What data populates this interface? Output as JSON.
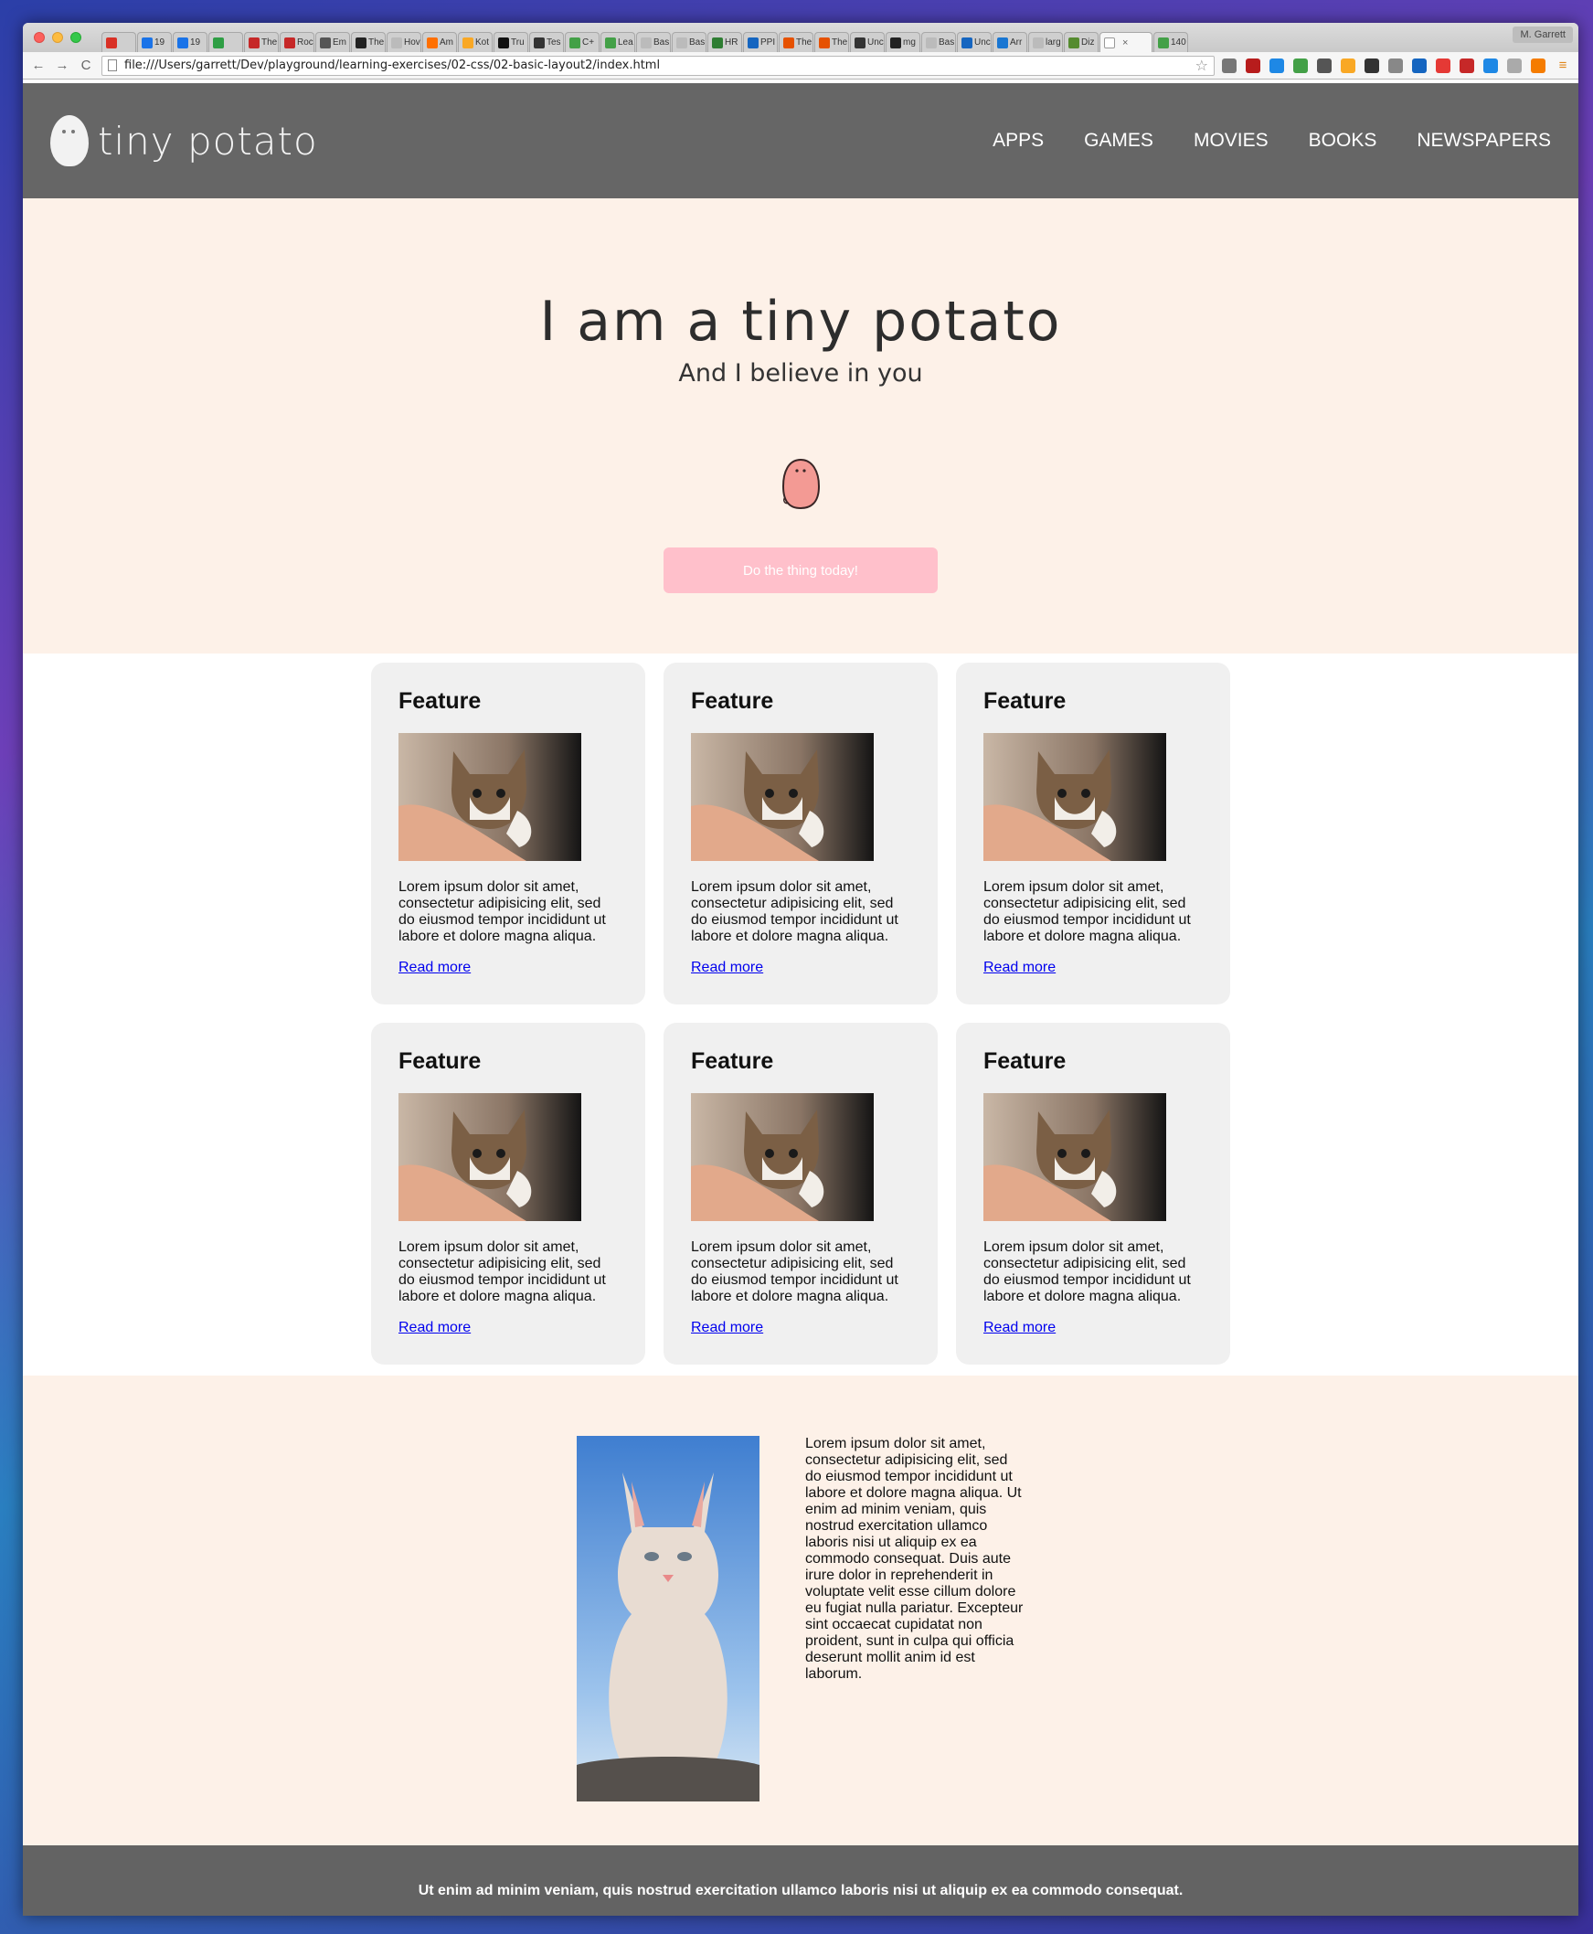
{
  "browser": {
    "tabs": [
      {
        "label": "",
        "color": "#d93025"
      },
      {
        "label": "19",
        "color": "#1a73e8"
      },
      {
        "label": "19",
        "color": "#1a73e8"
      },
      {
        "label": "",
        "color": "#2e9e44"
      },
      {
        "label": "The",
        "color": "#c62828"
      },
      {
        "label": "Roc",
        "color": "#c62828"
      },
      {
        "label": "Em",
        "color": "#555555"
      },
      {
        "label": "The",
        "color": "#222222"
      },
      {
        "label": "Hov",
        "color": "#bbbbbb"
      },
      {
        "label": "Am",
        "color": "#ff6f00"
      },
      {
        "label": "Kot",
        "color": "#f9a825"
      },
      {
        "label": "Tru",
        "color": "#111111"
      },
      {
        "label": "Tes",
        "color": "#333333"
      },
      {
        "label": "C+",
        "color": "#43a047"
      },
      {
        "label": "Lea",
        "color": "#43a047"
      },
      {
        "label": "Bas",
        "color": "#bbbbbb"
      },
      {
        "label": "Bas",
        "color": "#bbbbbb"
      },
      {
        "label": "HR",
        "color": "#2e7d32"
      },
      {
        "label": "PPI",
        "color": "#1565c0"
      },
      {
        "label": "The",
        "color": "#e65100"
      },
      {
        "label": "The",
        "color": "#e65100"
      },
      {
        "label": "Unc",
        "color": "#333333"
      },
      {
        "label": "mg",
        "color": "#222222"
      },
      {
        "label": "Bas",
        "color": "#bbbbbb"
      },
      {
        "label": "Unc",
        "color": "#1565c0"
      },
      {
        "label": "Arr",
        "color": "#1976d2"
      },
      {
        "label": "larg",
        "color": "#bbbbbb"
      },
      {
        "label": "Diz",
        "color": "#558b2f"
      }
    ],
    "active_tab": {
      "label": "",
      "close": "×"
    },
    "extra_tab": {
      "label": "140",
      "color": "#43a047"
    },
    "profile": "M. Garrett",
    "url": "file:///Users/garrett/Dev/playground/learning-exercises/02-css/02-basic-layout2/index.html",
    "back": "←",
    "forward": "→",
    "reload": "C",
    "star": "☆",
    "extensions": [
      "#777777",
      "#b71c1c",
      "#1e88e5",
      "#43a047",
      "#555555",
      "#f9a825",
      "#333333",
      "#888888",
      "#1565c0",
      "#e53935",
      "#c62828",
      "#1e88e5",
      "#aaaaaa",
      "#f57c00"
    ]
  },
  "site": {
    "logo_text": "tiny potato",
    "nav": [
      "APPS",
      "GAMES",
      "MOVIES",
      "BOOKS",
      "NEWSPAPERS"
    ],
    "hero": {
      "title": "I am a tiny potato",
      "subtitle": "And I believe in you",
      "cta": "Do the thing today!"
    },
    "features": [
      {
        "title": "Feature",
        "text": "Lorem ipsum dolor sit amet, consectetur adipisicing elit, sed do eiusmod tempor incididunt ut labore et dolore magna aliqua.",
        "link": "Read more"
      },
      {
        "title": "Feature",
        "text": "Lorem ipsum dolor sit amet, consectetur adipisicing elit, sed do eiusmod tempor incididunt ut labore et dolore magna aliqua.",
        "link": "Read more"
      },
      {
        "title": "Feature",
        "text": "Lorem ipsum dolor sit amet, consectetur adipisicing elit, sed do eiusmod tempor incididunt ut labore et dolore magna aliqua.",
        "link": "Read more"
      },
      {
        "title": "Feature",
        "text": "Lorem ipsum dolor sit amet, consectetur adipisicing elit, sed do eiusmod tempor incididunt ut labore et dolore magna aliqua.",
        "link": "Read more"
      },
      {
        "title": "Feature",
        "text": "Lorem ipsum dolor sit amet, consectetur adipisicing elit, sed do eiusmod tempor incididunt ut labore et dolore magna aliqua.",
        "link": "Read more"
      },
      {
        "title": "Feature",
        "text": "Lorem ipsum dolor sit amet, consectetur adipisicing elit, sed do eiusmod tempor incididunt ut labore et dolore magna aliqua.",
        "link": "Read more"
      }
    ],
    "about_text": "Lorem ipsum dolor sit amet, consectetur adipisicing elit, sed do eiusmod tempor incididunt ut labore et dolore magna aliqua. Ut enim ad minim veniam, quis nostrud exercitation ullamco laboris nisi ut aliquip ex ea commodo consequat. Duis aute irure dolor in reprehenderit in voluptate velit esse cillum dolore eu fugiat nulla pariatur. Excepteur sint occaecat cupidatat non proident, sunt in culpa qui officia deserunt mollit anim id est laborum.",
    "footer": "Ut enim ad minim veniam, quis nostrud exercitation ullamco laboris nisi ut aliquip ex ea commodo consequat.",
    "colors": {
      "header": "#666666",
      "hero_bg": "#fdf1e8",
      "cta": "#ffc0cb",
      "card": "#f0f0f0",
      "link": "#0000ee",
      "footer": "#636363"
    }
  }
}
